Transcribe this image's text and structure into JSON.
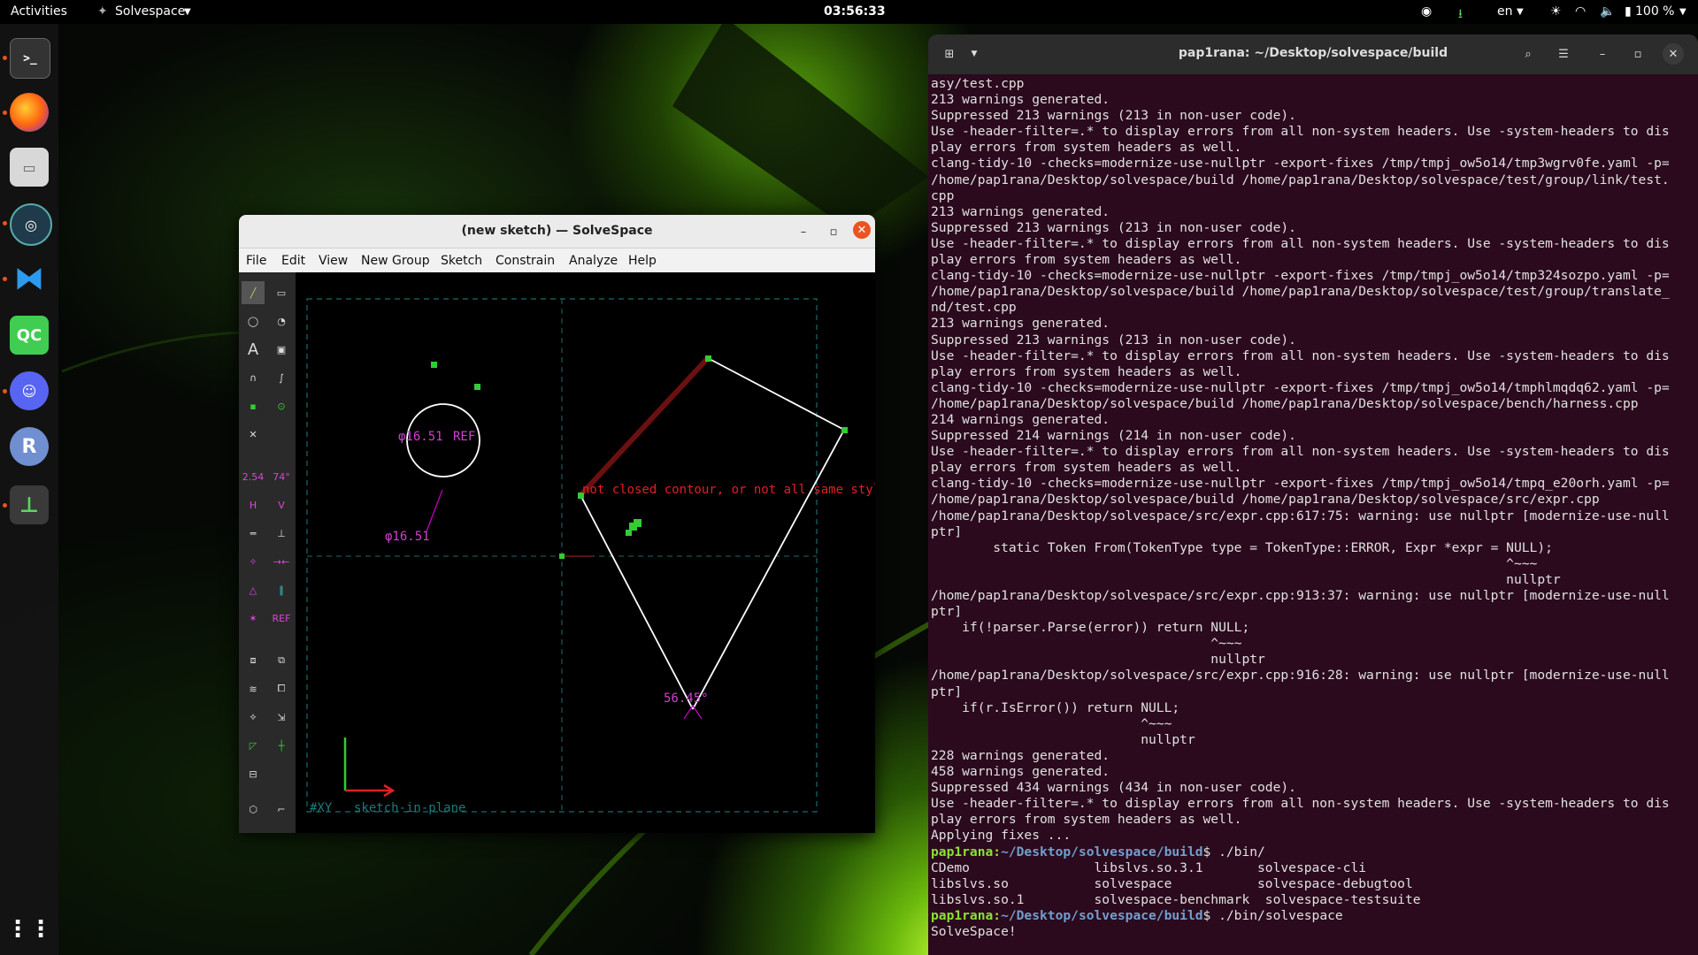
{
  "topbar": {
    "activities": "Activities",
    "app_name": "Solvespace",
    "clock": "03:56:33",
    "lang": "en",
    "battery": "100 %"
  },
  "dock": {
    "items": [
      "terminal-icon",
      "firefox-icon",
      "files-icon",
      "app-icon",
      "vscode-icon",
      "qt-creator-icon",
      "discord-icon",
      "r-icon",
      "solvespace-icon"
    ],
    "qt_label": "QC",
    "r_label": "R"
  },
  "solvespace": {
    "title": "(new sketch) — SolveSpace",
    "menu": [
      "File",
      "Edit",
      "View",
      "New Group",
      "Sketch",
      "Constrain",
      "Analyze",
      "Help"
    ],
    "canvas": {
      "diameter_label": "φ16.51",
      "diameter_label_ref": "φ16.51",
      "ref_label": "REF",
      "angle_label": "56.45°",
      "error_text": "not closed contour, or not all same style!",
      "plane_label": "#XY",
      "sketch_label": "sketch-in-plane",
      "tool_dim1": "2.54",
      "tool_dim2": "74°",
      "tool_h": "H",
      "tool_v": "V",
      "tool_ref": "REF"
    }
  },
  "terminal": {
    "title": "pap1rana: ~/Desktop/solvespace/build",
    "lines": [
      "asy/test.cpp",
      "213 warnings generated.",
      "Suppressed 213 warnings (213 in non-user code).",
      "Use -header-filter=.* to display errors from all non-system headers. Use -system-headers to dis",
      "play errors from system headers as well.",
      "clang-tidy-10 -checks=modernize-use-nullptr -export-fixes /tmp/tmpj_ow5o14/tmp3wgrv0fe.yaml -p=",
      "/home/pap1rana/Desktop/solvespace/build /home/pap1rana/Desktop/solvespace/test/group/link/test.",
      "cpp",
      "213 warnings generated.",
      "Suppressed 213 warnings (213 in non-user code).",
      "Use -header-filter=.* to display errors from all non-system headers. Use -system-headers to dis",
      "play errors from system headers as well.",
      "clang-tidy-10 -checks=modernize-use-nullptr -export-fixes /tmp/tmpj_ow5o14/tmp324sozpo.yaml -p=",
      "/home/pap1rana/Desktop/solvespace/build /home/pap1rana/Desktop/solvespace/test/group/translate_",
      "nd/test.cpp",
      "213 warnings generated.",
      "Suppressed 213 warnings (213 in non-user code).",
      "Use -header-filter=.* to display errors from all non-system headers. Use -system-headers to dis",
      "play errors from system headers as well.",
      "clang-tidy-10 -checks=modernize-use-nullptr -export-fixes /tmp/tmpj_ow5o14/tmphlmqdq62.yaml -p=",
      "/home/pap1rana/Desktop/solvespace/build /home/pap1rana/Desktop/solvespace/bench/harness.cpp",
      "214 warnings generated.",
      "Suppressed 214 warnings (214 in non-user code).",
      "Use -header-filter=.* to display errors from all non-system headers. Use -system-headers to dis",
      "play errors from system headers as well.",
      "clang-tidy-10 -checks=modernize-use-nullptr -export-fixes /tmp/tmpj_ow5o14/tmpq_e20orh.yaml -p=",
      "/home/pap1rana/Desktop/solvespace/build /home/pap1rana/Desktop/solvespace/src/expr.cpp",
      "/home/pap1rana/Desktop/solvespace/src/expr.cpp:617:75: warning: use nullptr [modernize-use-null",
      "ptr]",
      "        static Token From(TokenType type = TokenType::ERROR, Expr *expr = NULL);",
      "                                                                          ^~~~",
      "                                                                          nullptr",
      "/home/pap1rana/Desktop/solvespace/src/expr.cpp:913:37: warning: use nullptr [modernize-use-null",
      "ptr]",
      "    if(!parser.Parse(error)) return NULL;",
      "                                    ^~~~",
      "                                    nullptr",
      "/home/pap1rana/Desktop/solvespace/src/expr.cpp:916:28: warning: use nullptr [modernize-use-null",
      "ptr]",
      "    if(r.IsError()) return NULL;",
      "                           ^~~~",
      "                           nullptr",
      "228 warnings generated.",
      "458 warnings generated.",
      "Suppressed 434 warnings (434 in non-user code).",
      "Use -header-filter=.* to display errors from all non-system headers. Use -system-headers to dis",
      "play errors from system headers as well.",
      "Applying fixes ..."
    ],
    "prompt_user": "pap1rana:",
    "prompt_path": "~/Desktop/solvespace/build",
    "cmd1": "$ ./bin/",
    "ls_rows": [
      "CDemo                libslvs.so.3.1       solvespace-cli",
      "libslvs.so           solvespace           solvespace-debugtool",
      "libslvs.so.1         solvespace-benchmark  solvespace-testsuite"
    ],
    "cmd2": "$ ./bin/solvespace",
    "output_last": "SolveSpace!"
  }
}
